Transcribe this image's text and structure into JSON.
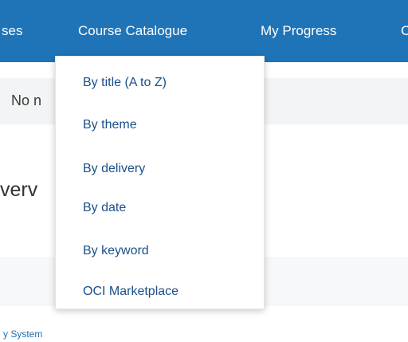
{
  "nav": {
    "items": [
      {
        "label": "ses"
      },
      {
        "label": "Course Catalogue"
      },
      {
        "label": "My Progress"
      },
      {
        "label": "C"
      }
    ]
  },
  "dropdown": {
    "items": [
      {
        "label": "By title (A to Z)"
      },
      {
        "label": "By theme"
      },
      {
        "label": "By delivery"
      },
      {
        "label": "By date"
      },
      {
        "label": "By keyword"
      },
      {
        "label": "OCI Marketplace"
      }
    ]
  },
  "content": {
    "notice_text": "No n",
    "section_title": "verv",
    "footer_text": "y System"
  },
  "colors": {
    "navbar": "#1f74b8",
    "menu_text": "#1a4f8a",
    "footer_link": "#1f6fb0"
  }
}
